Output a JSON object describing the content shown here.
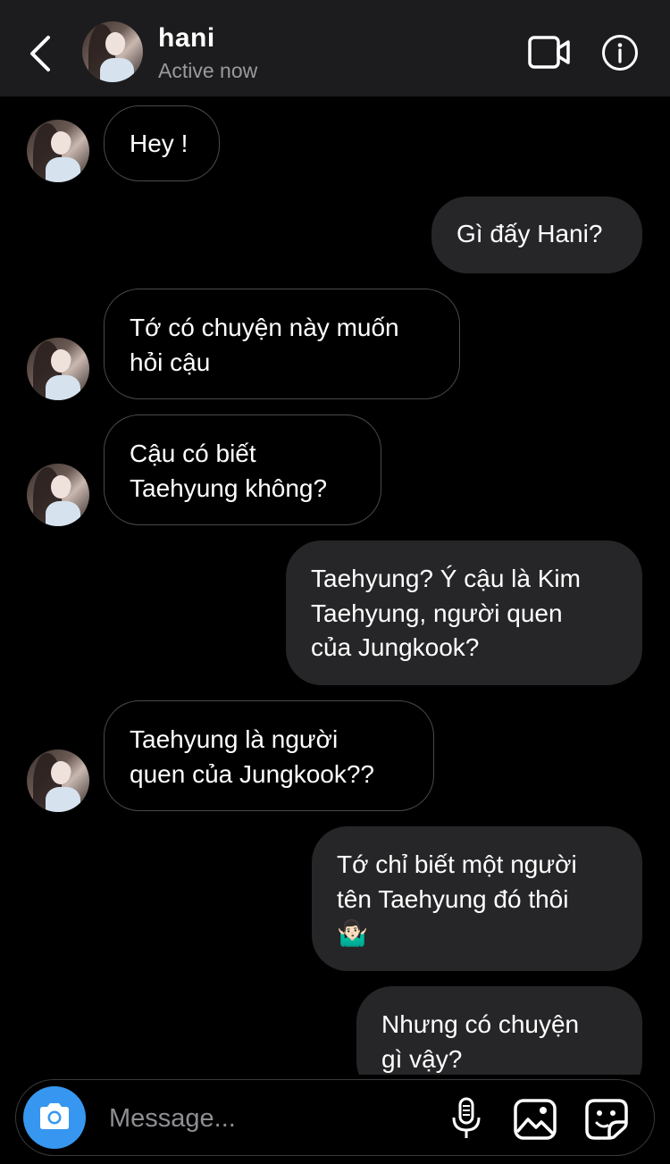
{
  "header": {
    "name": "hani",
    "status": "Active now",
    "icons": {
      "back": "chevron-left-icon",
      "video": "video-camera-icon",
      "info": "info-icon"
    }
  },
  "messages": [
    {
      "sender": "them",
      "text": "Hey !"
    },
    {
      "sender": "me",
      "text": "Gì đấy Hani?"
    },
    {
      "sender": "them",
      "lines": [
        "Tớ có chuyện này muốn",
        "hỏi cậu"
      ]
    },
    {
      "sender": "them",
      "lines": [
        "Cậu có biết",
        "Taehyung không?"
      ]
    },
    {
      "sender": "me",
      "lines": [
        "Taehyung? Ý cậu là Kim",
        "Taehyung, người quen",
        "của Jungkook?"
      ]
    },
    {
      "sender": "them",
      "lines": [
        "Taehyung là người",
        "quen của Jungkook??"
      ]
    },
    {
      "sender": "me",
      "lines": [
        "Tớ chỉ biết một người",
        "tên Taehyung đó thôi",
        "🤷🏻‍♂️"
      ]
    },
    {
      "sender": "me",
      "lines": [
        "Nhưng có chuyện",
        "gì vậy?"
      ]
    }
  ],
  "composer": {
    "placeholder": "Message...",
    "icons": {
      "camera": "camera-icon",
      "mic": "microphone-icon",
      "gallery": "image-gallery-icon",
      "sticker": "sticker-icon"
    }
  },
  "colors": {
    "background": "#000000",
    "header": "#1c1c1e",
    "outgoing_bubble": "#262628",
    "incoming_border": "#4a4a4e",
    "camera_button": "#3797f0",
    "status_text": "#9a9a9e"
  }
}
